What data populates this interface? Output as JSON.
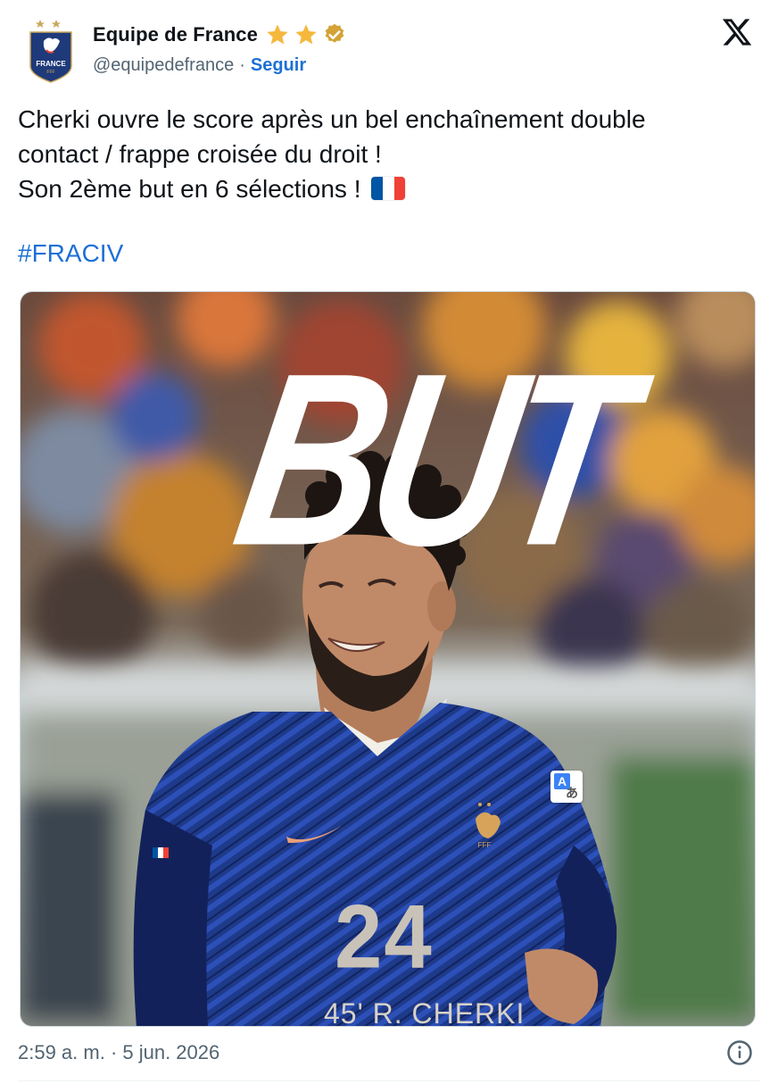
{
  "account": {
    "display_name": "Equipe de France",
    "handle": "@equipedefrance",
    "separator": "·",
    "follow_label": "Seguir",
    "badge_stars": 2,
    "verified": true,
    "logo_text": "FRANCE",
    "logo_subtext": "FFF"
  },
  "tweet": {
    "lines": [
      "Cherki ouvre le score après un bel enchaînement double",
      "contact / frappe croisée du droit !",
      "Son 2ème but en 6 sélections !"
    ],
    "hashtag": "#FRACIV",
    "flag_colors": [
      "#0055a4",
      "#ffffff",
      "#ef4135"
    ]
  },
  "media": {
    "headline": "BUT",
    "jersey_number": "24",
    "caption": "45' R. CHERKI"
  },
  "footer": {
    "timestamp": "2:59 a. m. · 5 jun. 2026"
  },
  "colors": {
    "link": "#1d6fd6",
    "secondary_text": "#536471",
    "star": "#f5b83d",
    "verified": "#d4a336"
  }
}
